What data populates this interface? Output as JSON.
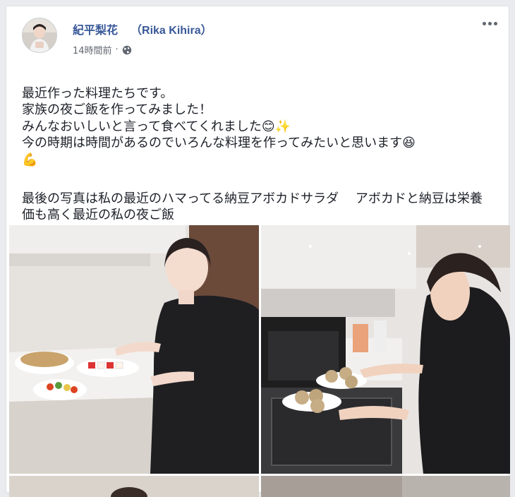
{
  "post": {
    "author_name": "紀平梨花",
    "author_latin": "（Rika Kihira）",
    "timestamp": "14時間前",
    "separator": "·",
    "privacy_icon": "globe-icon",
    "more_icon": "more-dots-icon",
    "paragraphs": [
      "最近作った料理たちです。\n家族の夜ご飯を作ってみました！\nみんなおいしいと言って食べてくれました😊✨\n今の時期は時間があるのでいろんな料理を作ってみたいと思います😆\n💪",
      "最後の写真は私の最近のハマってる納豆アボカドサラダ　 アボカドと納豆は栄養価も高く最近の私の夜ご飯"
    ]
  },
  "colors": {
    "page_bg": "#e9ebee",
    "link": "#385898",
    "text": "#1d2129",
    "meta": "#616770"
  }
}
